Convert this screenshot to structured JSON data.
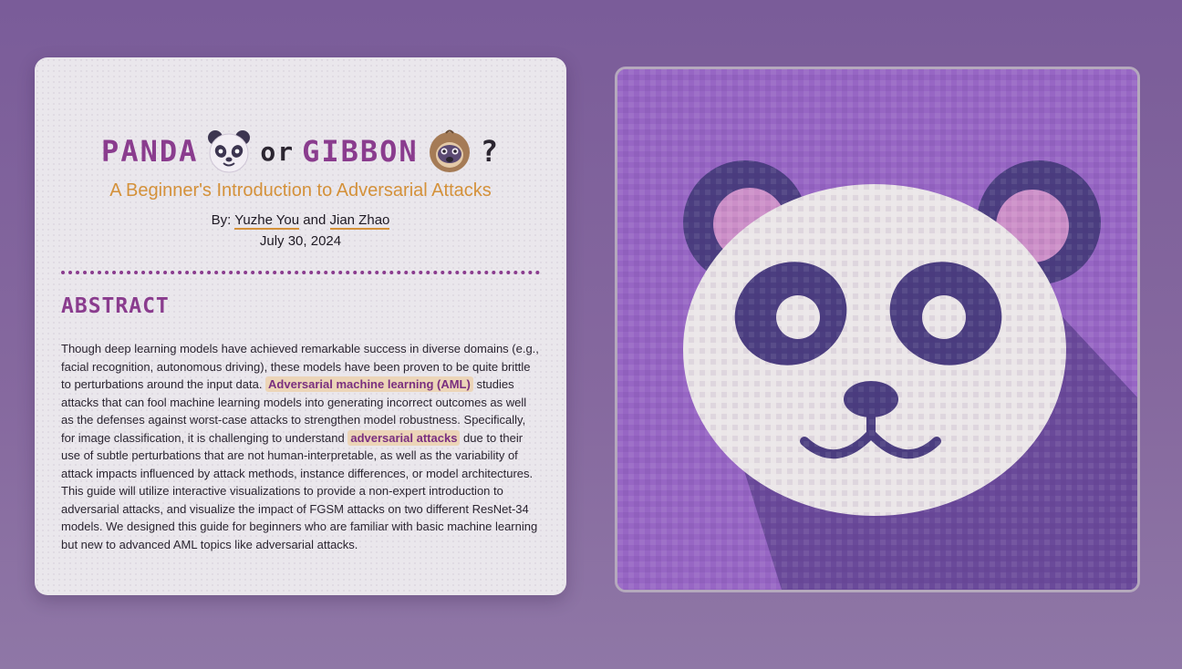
{
  "header": {
    "title_panda": "PANDA",
    "title_or": "or",
    "title_gibbon": "GIBBON",
    "title_question": "?",
    "subtitle": "A Beginner's Introduction to Adversarial Attacks",
    "by_prefix": "By:",
    "author1": "Yuzhe You",
    "and": "and",
    "author2": "Jian Zhao",
    "date": "July 30, 2024"
  },
  "abstract": {
    "heading": "ABSTRACT",
    "p1": "Though deep learning models have achieved remarkable success in diverse domains (e.g., facial recognition, autonomous driving), these models have been proven to be quite brittle to perturbations around the input data. ",
    "hl1": "Adversarial machine learning (AML)",
    "p2": " studies attacks that can fool machine learning models into generating incorrect outcomes as well as the defenses against worst-case attacks to strengthen model robustness. Specifically, for image classification, it is challenging to understand ",
    "hl2": "adversarial attacks",
    "p3": " due to their use of subtle perturbations that are not human-interpretable, as well as the variability of attack impacts influenced by attack methods, instance differences, or model architectures. This guide will utilize interactive visualizations to provide a non-expert introduction to adversarial attacks, and visualize the impact of FGSM attacks on two different ResNet-34 models. We designed this guide for beginners who are familiar with basic machine learning but new to advanced AML topics like adversarial attacks."
  },
  "icons": {
    "panda": "panda-face-icon",
    "gibbon": "monkey-face-icon"
  },
  "colors": {
    "accent_purple": "#8a3c8e",
    "accent_orange": "#d4913a",
    "background": "#7a5c99"
  }
}
